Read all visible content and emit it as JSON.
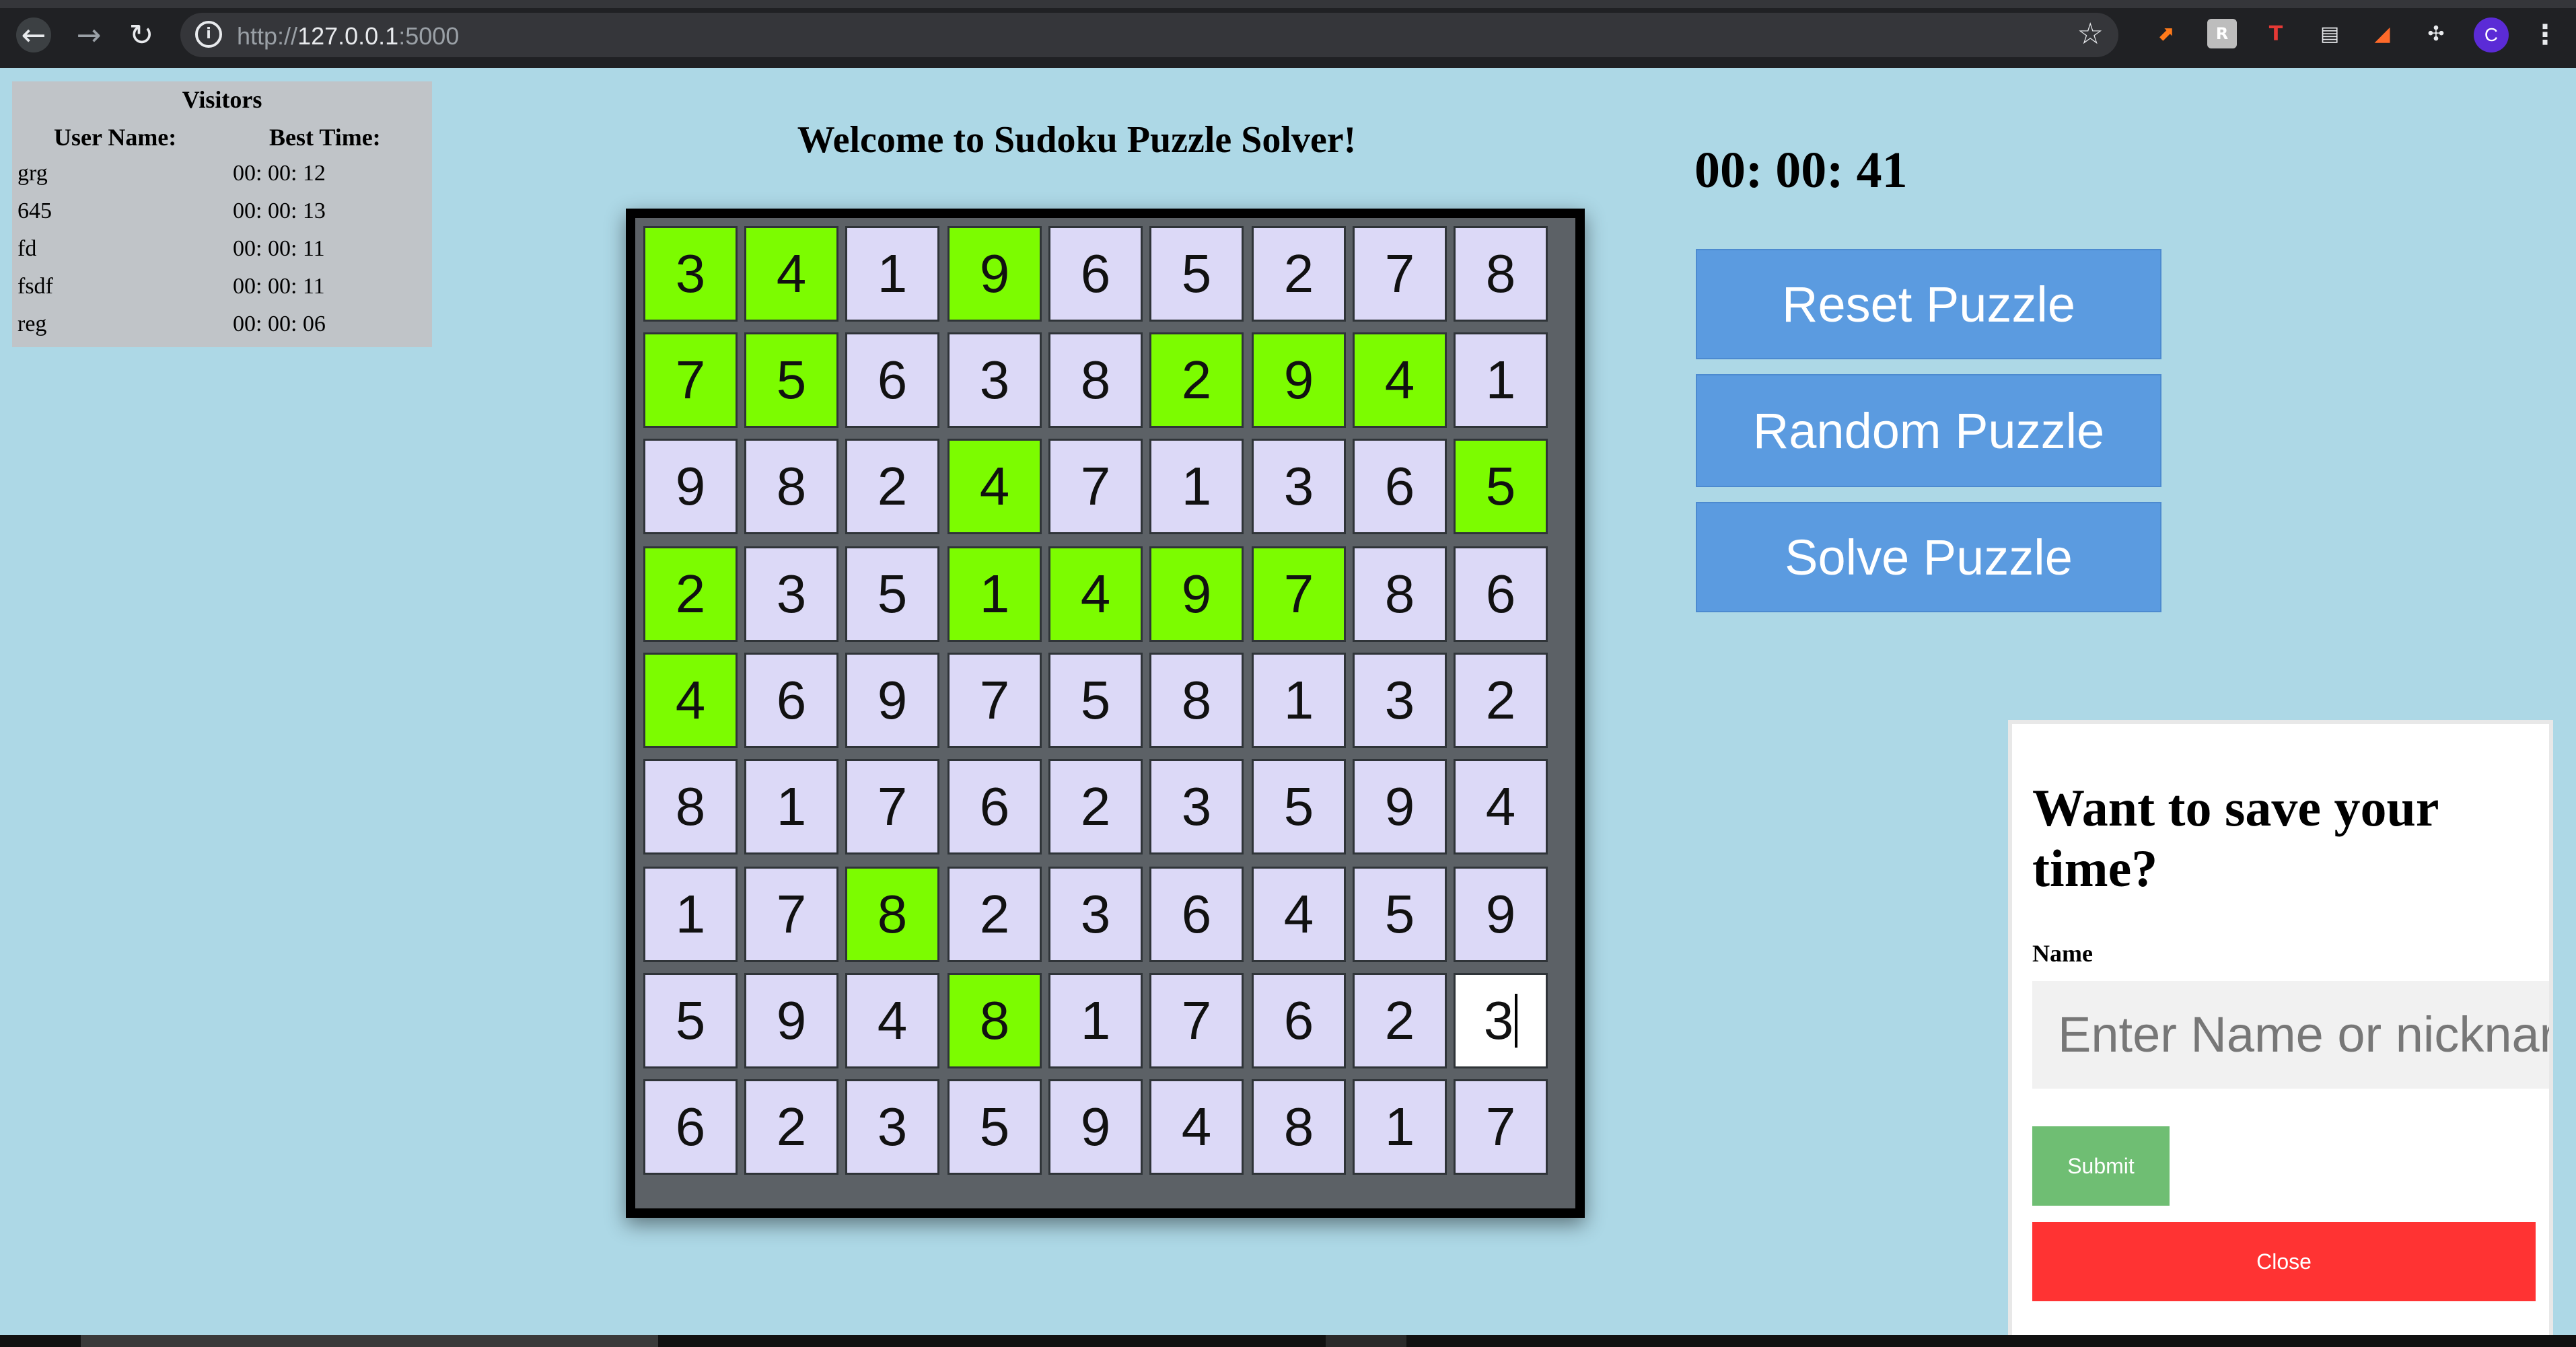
{
  "browser": {
    "url_prefix": "http://",
    "url_host": "127.0.0.1",
    "url_port": ":5000",
    "avatar_letter": "C"
  },
  "visitors": {
    "title": "Visitors",
    "col_name": "User Name:",
    "col_time": "Best Time:",
    "rows": [
      {
        "name": "grg",
        "time": "00: 00: 12"
      },
      {
        "name": "645",
        "time": "00: 00: 13"
      },
      {
        "name": "fd",
        "time": "00: 00: 11"
      },
      {
        "name": "fsdf",
        "time": "00: 00: 11"
      },
      {
        "name": "reg",
        "time": "00: 00: 06"
      }
    ]
  },
  "title": "Welcome to Sudoku Puzzle Solver!",
  "timer": "00: 00: 41",
  "buttons": {
    "reset": "Reset Puzzle",
    "random": "Random Puzzle",
    "solve": "Solve Puzzle"
  },
  "board": {
    "values": [
      [
        3,
        4,
        1,
        9,
        6,
        5,
        2,
        7,
        8
      ],
      [
        7,
        5,
        6,
        3,
        8,
        2,
        9,
        4,
        1
      ],
      [
        9,
        8,
        2,
        4,
        7,
        1,
        3,
        6,
        5
      ],
      [
        2,
        3,
        5,
        1,
        4,
        9,
        7,
        8,
        6
      ],
      [
        4,
        6,
        9,
        7,
        5,
        8,
        1,
        3,
        2
      ],
      [
        8,
        1,
        7,
        6,
        2,
        3,
        5,
        9,
        4
      ],
      [
        1,
        7,
        8,
        2,
        3,
        6,
        4,
        5,
        9
      ],
      [
        5,
        9,
        4,
        8,
        1,
        7,
        6,
        2,
        3
      ],
      [
        6,
        2,
        3,
        5,
        9,
        4,
        8,
        1,
        7
      ]
    ],
    "given": [
      [
        1,
        1,
        0,
        1,
        0,
        0,
        0,
        0,
        0
      ],
      [
        1,
        1,
        0,
        0,
        0,
        1,
        1,
        1,
        0
      ],
      [
        0,
        0,
        0,
        1,
        0,
        0,
        0,
        0,
        1
      ],
      [
        1,
        0,
        0,
        1,
        1,
        1,
        1,
        0,
        0
      ],
      [
        1,
        0,
        0,
        0,
        0,
        0,
        0,
        0,
        0
      ],
      [
        0,
        0,
        0,
        0,
        0,
        0,
        0,
        0,
        0
      ],
      [
        0,
        0,
        1,
        0,
        0,
        0,
        0,
        0,
        0
      ],
      [
        0,
        0,
        0,
        1,
        0,
        0,
        0,
        0,
        0
      ],
      [
        0,
        0,
        0,
        0,
        0,
        0,
        0,
        0,
        0
      ]
    ],
    "active_cell": {
      "row": 7,
      "col": 8
    },
    "colors": {
      "given": "#7cfc00",
      "empty": "#dcd9f7",
      "active": "#ffffff"
    }
  },
  "popup": {
    "title": "Want to save your time?",
    "label": "Name",
    "placeholder": "Enter Name or nicknar",
    "submit": "Submit",
    "close": "Close"
  },
  "colors": {
    "background": "#add8e6",
    "button": "#5b9be0",
    "submit": "#6fbe73",
    "close": "#ff3333"
  }
}
